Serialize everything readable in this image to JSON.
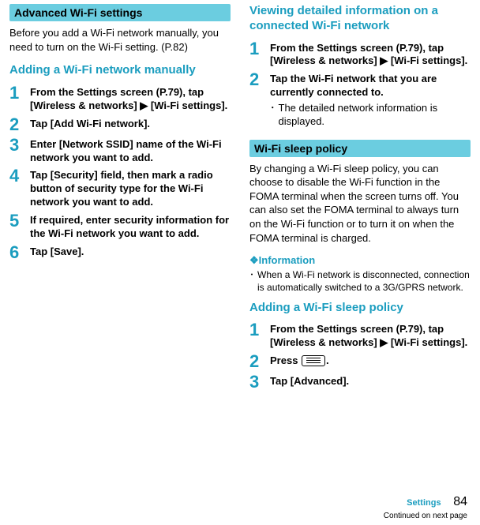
{
  "left": {
    "section_title": "Advanced Wi-Fi settings",
    "intro": "Before you add a Wi-Fi network manually, you need to turn on the Wi-Fi setting. (P.82)",
    "heading": "Adding a Wi-Fi network manually",
    "steps": {
      "s1_num": "1",
      "s1": "From the Settings screen (P.79), tap [Wireless & networks] ▶ [Wi-Fi settings].",
      "s2_num": "2",
      "s2": "Tap [Add Wi-Fi network].",
      "s3_num": "3",
      "s3": "Enter [Network SSID] name of the Wi-Fi network you want to add.",
      "s4_num": "4",
      "s4": "Tap [Security] field, then mark a radio button of security type for the Wi-Fi network you want to add.",
      "s5_num": "5",
      "s5": "If required, enter security information for the Wi-Fi network you want to add.",
      "s6_num": "6",
      "s6": "Tap [Save]."
    }
  },
  "right": {
    "heading1": "Viewing detailed information on a connected Wi-Fi network",
    "sec1": {
      "s1_num": "1",
      "s1": "From the Settings screen (P.79), tap [Wireless & networks] ▶ [Wi-Fi settings].",
      "s2_num": "2",
      "s2": "Tap the Wi-Fi network that you are currently connected to.",
      "s2_sub": "The detailed network information is displayed."
    },
    "section_title": "Wi-Fi sleep policy",
    "intro": "By changing a Wi-Fi sleep policy, you can choose to disable the Wi-Fi function in the FOMA terminal when the screen turns off. You can also set the FOMA terminal to always turn on the Wi-Fi function or to turn it on when the FOMA terminal is charged.",
    "info_symbol": "❖",
    "info_label": "Information",
    "info_item": "When a Wi-Fi network is disconnected, connection is automatically switched to a 3G/GPRS network.",
    "heading2": "Adding a Wi-Fi sleep policy",
    "sec2": {
      "s1_num": "1",
      "s1": "From the Settings screen (P.79), tap [Wireless & networks] ▶ [Wi-Fi settings].",
      "s2_num": "2",
      "s2_pre": "Press ",
      "s2_post": ".",
      "s3_num": "3",
      "s3": "Tap [Advanced]."
    }
  },
  "footer": {
    "category": "Settings",
    "page": "84",
    "continued": "Continued on next page"
  }
}
